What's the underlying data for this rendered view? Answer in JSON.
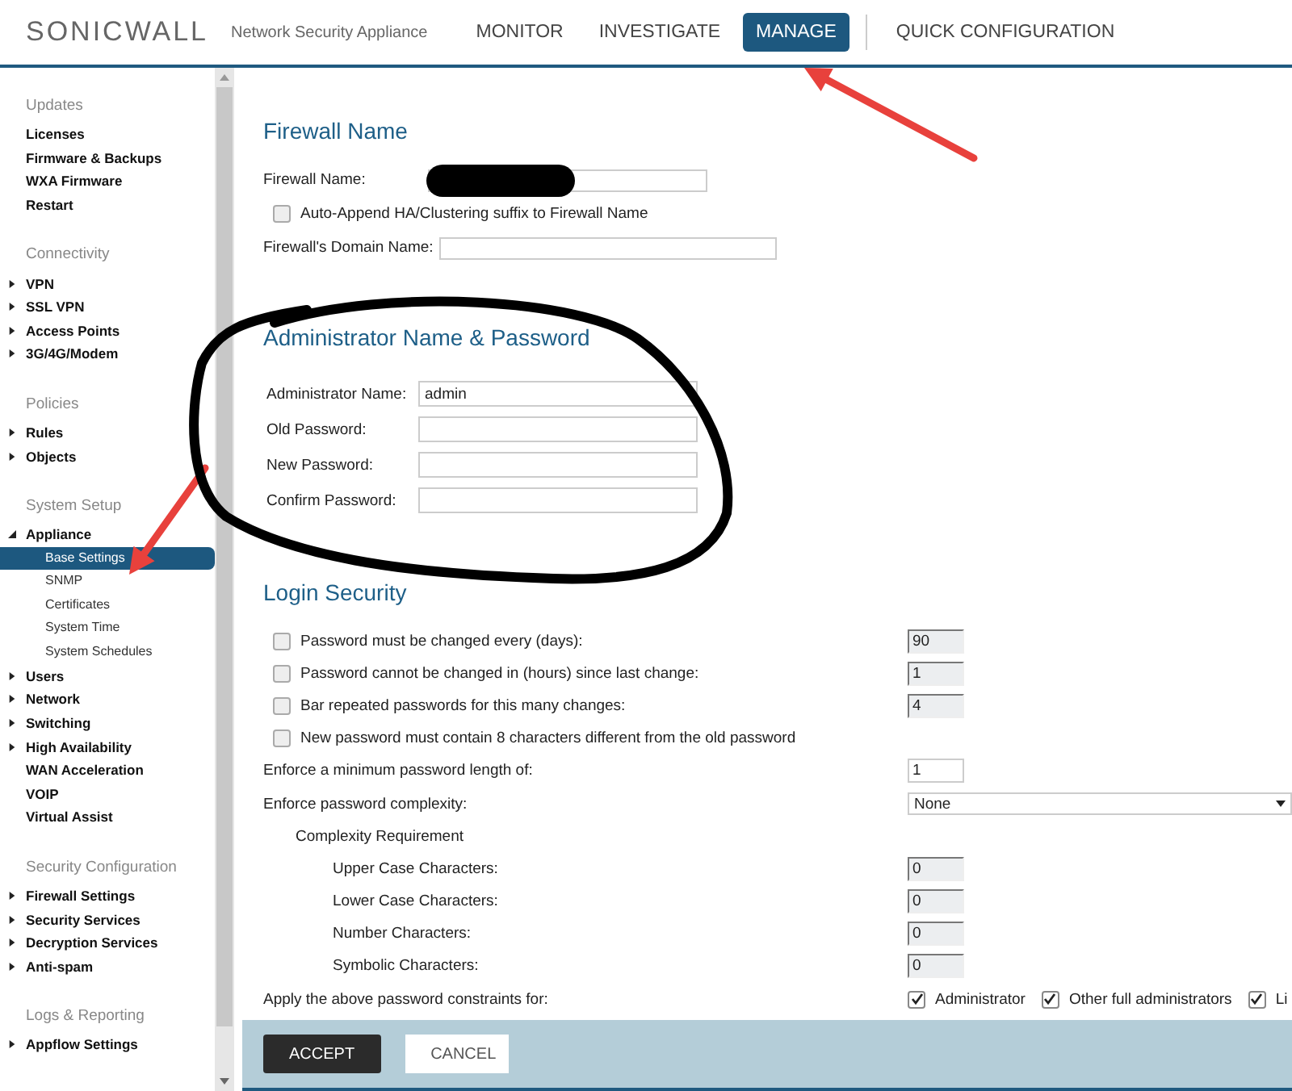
{
  "header": {
    "brand": "SONICWALL",
    "subtitle": "Network Security Appliance",
    "nav": [
      {
        "label": "MONITOR",
        "selected": false
      },
      {
        "label": "INVESTIGATE",
        "selected": false
      },
      {
        "label": "MANAGE",
        "selected": true
      },
      {
        "label": "QUICK CONFIGURATION",
        "selected": false
      }
    ]
  },
  "sidebar": {
    "sections": [
      {
        "title": "Updates",
        "items": [
          {
            "label": "Licenses",
            "kind": "leaf"
          },
          {
            "label": "Firmware & Backups",
            "kind": "leaf"
          },
          {
            "label": "WXA Firmware",
            "kind": "leaf"
          },
          {
            "label": "Restart",
            "kind": "leaf"
          }
        ]
      },
      {
        "title": "Connectivity",
        "items": [
          {
            "label": "VPN",
            "kind": "folder",
            "expanded": false
          },
          {
            "label": "SSL VPN",
            "kind": "folder",
            "expanded": false
          },
          {
            "label": "Access Points",
            "kind": "folder",
            "expanded": false
          },
          {
            "label": "3G/4G/Modem",
            "kind": "folder",
            "expanded": false
          }
        ]
      },
      {
        "title": "Policies",
        "items": [
          {
            "label": "Rules",
            "kind": "folder",
            "expanded": false
          },
          {
            "label": "Objects",
            "kind": "folder",
            "expanded": false
          }
        ]
      },
      {
        "title": "System Setup",
        "items": [
          {
            "label": "Appliance",
            "kind": "folder",
            "expanded": true,
            "children": [
              {
                "label": "Base Settings",
                "selected": true
              },
              {
                "label": "SNMP",
                "selected": false
              },
              {
                "label": "Certificates",
                "selected": false
              },
              {
                "label": "System Time",
                "selected": false
              },
              {
                "label": "System Schedules",
                "selected": false
              }
            ]
          },
          {
            "label": "Users",
            "kind": "folder",
            "expanded": false
          },
          {
            "label": "Network",
            "kind": "folder",
            "expanded": false
          },
          {
            "label": "Switching",
            "kind": "folder",
            "expanded": false
          },
          {
            "label": "High Availability",
            "kind": "folder",
            "expanded": false
          },
          {
            "label": "WAN Acceleration",
            "kind": "leaf"
          },
          {
            "label": "VOIP",
            "kind": "leaf"
          },
          {
            "label": "Virtual Assist",
            "kind": "leaf"
          }
        ]
      },
      {
        "title": "Security Configuration",
        "items": [
          {
            "label": "Firewall Settings",
            "kind": "folder",
            "expanded": false
          },
          {
            "label": "Security Services",
            "kind": "folder",
            "expanded": false
          },
          {
            "label": "Decryption Services",
            "kind": "folder",
            "expanded": false
          },
          {
            "label": "Anti-spam",
            "kind": "folder",
            "expanded": false
          }
        ]
      },
      {
        "title": "Logs & Reporting",
        "items": [
          {
            "label": "Appflow Settings",
            "kind": "folder",
            "expanded": false
          }
        ]
      }
    ]
  },
  "firewall_name": {
    "heading": "Firewall Name",
    "name_label": "Firewall Name:",
    "name_redacted": true,
    "auto_append": {
      "label": "Auto-Append HA/Clustering suffix to Firewall Name",
      "checked": false
    },
    "domain_label": "Firewall's Domain Name:"
  },
  "administrator": {
    "heading": "Administrator Name & Password",
    "fields": [
      {
        "label": "Administrator Name:",
        "value": "admin"
      },
      {
        "label": "Old Password:"
      },
      {
        "label": "New Password:"
      },
      {
        "label": "Confirm Password:"
      }
    ]
  },
  "login_security": {
    "heading": "Login Security",
    "rows": [
      {
        "kind": "check",
        "label": "Password must be changed every (days):",
        "checked": false,
        "value": "90",
        "disabled": true
      },
      {
        "kind": "check",
        "label": "Password cannot be changed in (hours) since last change:",
        "checked": false,
        "value": "1",
        "disabled": true
      },
      {
        "kind": "check",
        "label": "Bar repeated passwords for this many changes:",
        "checked": false,
        "value": "4",
        "disabled": true
      },
      {
        "kind": "check",
        "label": "New password must contain 8 characters different from the old password",
        "checked": false
      },
      {
        "kind": "input",
        "label": "Enforce a minimum password length of:",
        "value": "1",
        "disabled": false
      },
      {
        "kind": "select",
        "label": "Enforce password complexity:",
        "value": "None"
      },
      {
        "kind": "subheading",
        "label": "Complexity Requirement"
      },
      {
        "kind": "count",
        "label": "Upper Case Characters:",
        "value": "0",
        "disabled": true
      },
      {
        "kind": "count",
        "label": "Lower Case Characters:",
        "value": "0",
        "disabled": true
      },
      {
        "kind": "count",
        "label": "Number Characters:",
        "value": "0",
        "disabled": true
      },
      {
        "kind": "count",
        "label": "Symbolic Characters:",
        "value": "0",
        "disabled": true
      },
      {
        "kind": "apply",
        "label": "Apply the above password constraints for:",
        "options": [
          {
            "label": "Administrator",
            "checked": true
          },
          {
            "label": "Other full administrators",
            "checked": true
          },
          {
            "label": "Li",
            "checked": true
          }
        ]
      }
    ]
  },
  "footer": {
    "buttons": [
      {
        "label": "ACCEPT",
        "kind": "primary"
      },
      {
        "label": "CANCEL",
        "kind": "secondary"
      }
    ]
  },
  "annotations": [
    {
      "kind": "arrow"
    },
    {
      "kind": "arrow"
    },
    {
      "kind": "circle"
    }
  ]
}
